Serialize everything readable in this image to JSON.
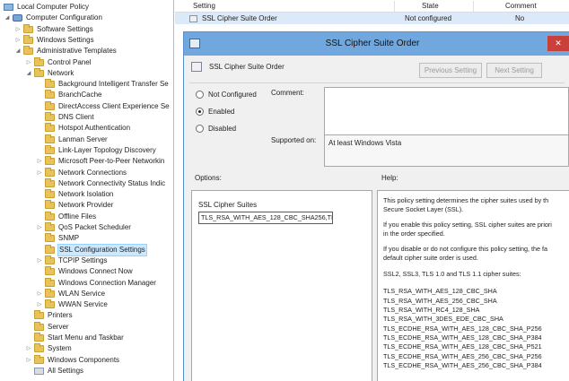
{
  "tree": {
    "items": [
      {
        "label": "Local Computer Policy",
        "level": 0,
        "expander": "",
        "icon": "computer-icon"
      },
      {
        "label": "Computer Configuration",
        "level": 1,
        "expander": "◢",
        "icon": "configuration-icon"
      },
      {
        "label": "Software Settings",
        "level": 2,
        "expander": "▷",
        "icon": "folder-icon"
      },
      {
        "label": "Windows Settings",
        "level": 2,
        "expander": "▷",
        "icon": "folder-icon"
      },
      {
        "label": "Administrative Templates",
        "level": 2,
        "expander": "◢",
        "icon": "folder-icon"
      },
      {
        "label": "Control Panel",
        "level": 3,
        "expander": "▷",
        "icon": "folder-icon"
      },
      {
        "label": "Network",
        "level": 3,
        "expander": "◢",
        "icon": "folder-icon"
      },
      {
        "label": "Background Intelligent Transfer Se",
        "level": 4,
        "expander": "",
        "icon": "folder-icon"
      },
      {
        "label": "BranchCache",
        "level": 4,
        "expander": "",
        "icon": "folder-icon"
      },
      {
        "label": "DirectAccess Client Experience Se",
        "level": 4,
        "expander": "",
        "icon": "folder-icon"
      },
      {
        "label": "DNS Client",
        "level": 4,
        "expander": "",
        "icon": "folder-icon"
      },
      {
        "label": "Hotspot Authentication",
        "level": 4,
        "expander": "",
        "icon": "folder-icon"
      },
      {
        "label": "Lanman Server",
        "level": 4,
        "expander": "",
        "icon": "folder-icon"
      },
      {
        "label": "Link-Layer Topology Discovery",
        "level": 4,
        "expander": "",
        "icon": "folder-icon"
      },
      {
        "label": "Microsoft Peer-to-Peer Networkin",
        "level": 4,
        "expander": "▷",
        "icon": "folder-icon"
      },
      {
        "label": "Network Connections",
        "level": 4,
        "expander": "▷",
        "icon": "folder-icon"
      },
      {
        "label": "Network Connectivity Status Indic",
        "level": 4,
        "expander": "",
        "icon": "folder-icon"
      },
      {
        "label": "Network Isolation",
        "level": 4,
        "expander": "",
        "icon": "folder-icon"
      },
      {
        "label": "Network Provider",
        "level": 4,
        "expander": "",
        "icon": "folder-icon"
      },
      {
        "label": "Offline Files",
        "level": 4,
        "expander": "",
        "icon": "folder-icon"
      },
      {
        "label": "QoS Packet Scheduler",
        "level": 4,
        "expander": "▷",
        "icon": "folder-icon"
      },
      {
        "label": "SNMP",
        "level": 4,
        "expander": "",
        "icon": "folder-icon"
      },
      {
        "label": "SSL Configuration Settings",
        "level": 4,
        "expander": "",
        "icon": "folder-icon",
        "selected": true
      },
      {
        "label": "TCPIP Settings",
        "level": 4,
        "expander": "▷",
        "icon": "folder-icon"
      },
      {
        "label": "Windows Connect Now",
        "level": 4,
        "expander": "",
        "icon": "folder-icon"
      },
      {
        "label": "Windows Connection Manager",
        "level": 4,
        "expander": "",
        "icon": "folder-icon"
      },
      {
        "label": "WLAN Service",
        "level": 4,
        "expander": "▷",
        "icon": "folder-icon"
      },
      {
        "label": "WWAN Service",
        "level": 4,
        "expander": "▷",
        "icon": "folder-icon"
      },
      {
        "label": "Printers",
        "level": 3,
        "expander": "",
        "icon": "folder-icon"
      },
      {
        "label": "Server",
        "level": 3,
        "expander": "",
        "icon": "folder-icon"
      },
      {
        "label": "Start Menu and Taskbar",
        "level": 3,
        "expander": "",
        "icon": "folder-icon"
      },
      {
        "label": "System",
        "level": 3,
        "expander": "▷",
        "icon": "folder-icon"
      },
      {
        "label": "Windows Components",
        "level": 3,
        "expander": "▷",
        "icon": "folder-icon"
      },
      {
        "label": "All Settings",
        "level": 3,
        "expander": "",
        "icon": "settings-icon"
      }
    ]
  },
  "list": {
    "headers": {
      "setting": "Setting",
      "state": "State",
      "comment": "Comment"
    },
    "row": {
      "setting": "SSL Cipher Suite Order",
      "state": "Not configured",
      "comment": "No"
    }
  },
  "dialog": {
    "title": "SSL Cipher Suite Order",
    "close_glyph": "✕",
    "setting_name": "SSL Cipher Suite Order",
    "previous_button": "Previous Setting",
    "next_button": "Next Setting",
    "radios": {
      "not_configured": "Not Configured",
      "enabled": "Enabled",
      "disabled": "Disabled",
      "selected": "enabled"
    },
    "comment_label": "Comment:",
    "comment_value": "",
    "supported_label": "Supported on:",
    "supported_value": "At least Windows Vista",
    "options_label": "Options:",
    "help_label": "Help:",
    "cipher_label": "SSL Cipher Suites",
    "cipher_value": "TLS_RSA_WITH_AES_128_CBC_SHA256,TI",
    "help_lines": [
      "This policy setting determines the cipher suites used by th",
      "Secure Socket Layer (SSL).",
      "If you enable this policy setting, SSL cipher suites are priori",
      "in the order specified.",
      "If you disable or do not configure this policy setting, the fa",
      "default cipher suite order is used.",
      "SSL2, SSL3, TLS 1.0 and TLS 1.1 cipher suites:",
      "TLS_RSA_WITH_AES_128_CBC_SHA",
      "TLS_RSA_WITH_AES_256_CBC_SHA",
      "TLS_RSA_WITH_RC4_128_SHA",
      "TLS_RSA_WITH_3DES_EDE_CBC_SHA",
      "TLS_ECDHE_RSA_WITH_AES_128_CBC_SHA_P256",
      "TLS_ECDHE_RSA_WITH_AES_128_CBC_SHA_P384",
      "TLS_ECDHE_RSA_WITH_AES_128_CBC_SHA_P521",
      "TLS_ECDHE_RSA_WITH_AES_256_CBC_SHA_P256",
      "TLS_ECDHE_RSA_WITH_AES_256_CBC_SHA_P384"
    ]
  },
  "colors": {
    "titlebar": "#6fa7de",
    "selection": "#cce8ff",
    "folder": "#e8c25b",
    "close": "#c9403a"
  }
}
